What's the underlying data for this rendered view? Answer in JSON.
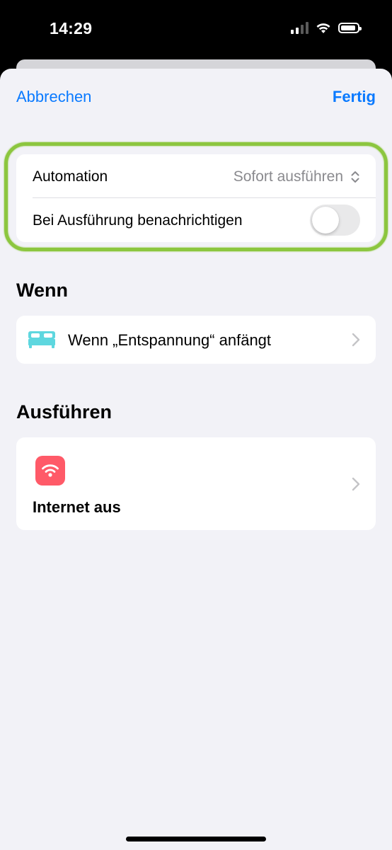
{
  "status_bar": {
    "time": "14:29",
    "icons": [
      "cellular-signal-icon",
      "wifi-icon",
      "battery-icon"
    ]
  },
  "nav": {
    "cancel_label": "Abbrechen",
    "done_label": "Fertig"
  },
  "settings": {
    "automation_label": "Automation",
    "automation_value": "Sofort ausführen",
    "notify_label": "Bei Ausführung benachrichtigen",
    "notify_enabled": false
  },
  "when_section": {
    "title": "Wenn",
    "trigger_label": "Wenn „Entspannung“ anfängt",
    "icon": "bed-icon"
  },
  "do_section": {
    "title": "Ausführen",
    "action_label": "Internet aus",
    "icon": "wifi-icon"
  },
  "colors": {
    "accent": "#0a7aff",
    "highlight": "#8cc63f",
    "bed": "#5ed7df",
    "wifi_tile": "#ff5a68",
    "background": "#f2f2f7"
  }
}
